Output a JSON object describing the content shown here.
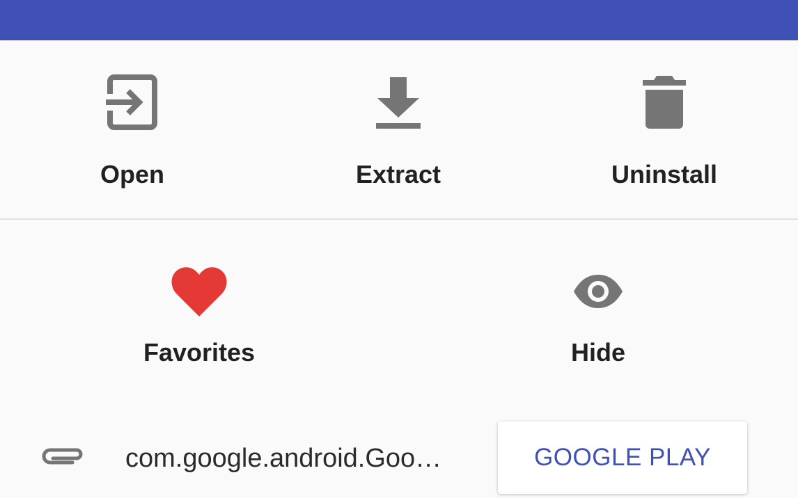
{
  "app_bar": {
    "color": "#3f51b5"
  },
  "actions": {
    "open": {
      "label": "Open",
      "icon": "open-in-icon"
    },
    "extract": {
      "label": "Extract",
      "icon": "download-icon"
    },
    "uninstall": {
      "label": "Uninstall",
      "icon": "trash-icon"
    },
    "favorites": {
      "label": "Favorites",
      "icon": "heart-icon",
      "color": "#e53935"
    },
    "hide": {
      "label": "Hide",
      "icon": "eye-icon"
    }
  },
  "footer": {
    "package_name": "com.google.android.Goo…",
    "play_button_label": "GOOGLE PLAY",
    "accent": "#3f51b5"
  }
}
